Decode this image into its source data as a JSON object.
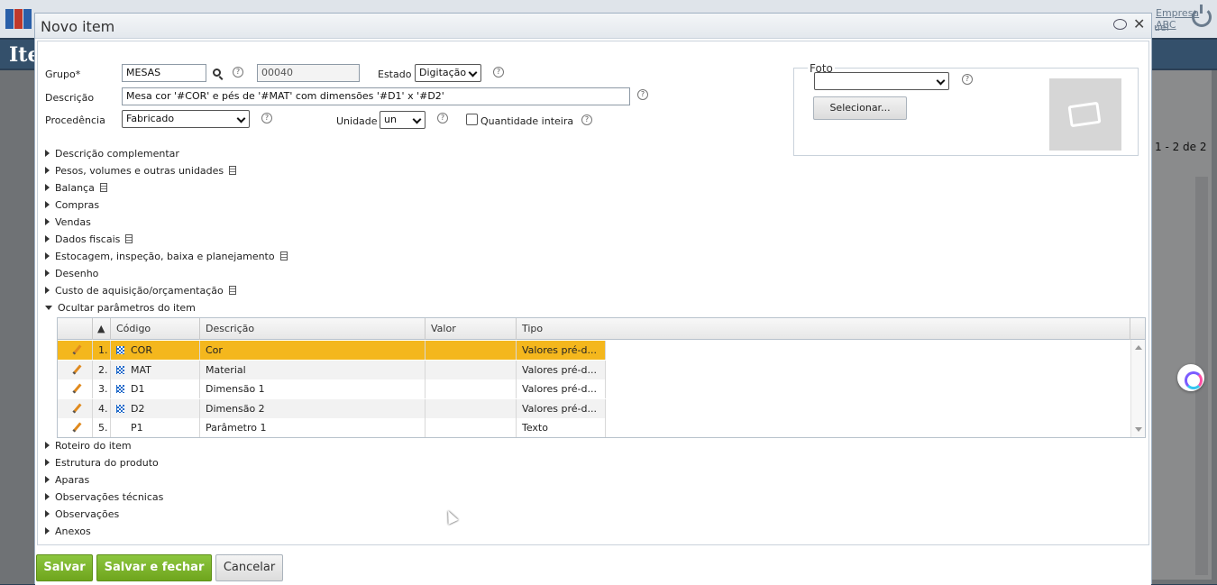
{
  "background": {
    "company": "Empresa ABC",
    "user": "uel",
    "page_title": "Ite",
    "pager": "1 - 2 de 2"
  },
  "modal": {
    "title": "Novo item",
    "form": {
      "grupo_label": "Grupo*",
      "grupo_value": "MESAS",
      "code_value": "00040",
      "estado_label": "Estado",
      "estado_value": "Digitação",
      "descricao_label": "Descrição",
      "descricao_value": "Mesa cor '#COR' e pés de '#MAT' com dimensões '#D1' x '#D2'",
      "procedencia_label": "Procedência",
      "procedencia_value": "Fabricado",
      "unidade_label": "Unidade",
      "unidade_value": "un",
      "qtd_inteira_label": "Quantidade inteira",
      "help_glyph": "?"
    },
    "foto": {
      "legend": "Foto",
      "select_value": "",
      "select_button": "Selecionar..."
    },
    "sections_top": [
      {
        "label": "Descrição complementar",
        "doc": false
      },
      {
        "label": "Pesos, volumes e outras unidades",
        "doc": true
      },
      {
        "label": "Balança",
        "doc": true
      },
      {
        "label": "Compras",
        "doc": false
      },
      {
        "label": "Vendas",
        "doc": false
      },
      {
        "label": "Dados fiscais",
        "doc": true
      },
      {
        "label": "Estocagem, inspeção, baixa e planejamento",
        "doc": true
      },
      {
        "label": "Desenho",
        "doc": false
      },
      {
        "label": "Custo de aquisição/orçamentação",
        "doc": true
      }
    ],
    "params_section": "Ocultar parâmetros do item",
    "grid": {
      "columns": [
        "Código",
        "Descrição",
        "Valor",
        "Tipo"
      ],
      "rows": [
        {
          "n": "1.",
          "code": "COR",
          "desc": "Cor",
          "valor": "",
          "tipo": "Valores pré-d...",
          "flag": true,
          "selected": true
        },
        {
          "n": "2.",
          "code": "MAT",
          "desc": "Material",
          "valor": "",
          "tipo": "Valores pré-d...",
          "flag": true,
          "selected": false
        },
        {
          "n": "3.",
          "code": "D1",
          "desc": "Dimensão 1",
          "valor": "",
          "tipo": "Valores pré-d...",
          "flag": true,
          "selected": false
        },
        {
          "n": "4.",
          "code": "D2",
          "desc": "Dimensão 2",
          "valor": "",
          "tipo": "Valores pré-d...",
          "flag": true,
          "selected": false
        },
        {
          "n": "5.",
          "code": "P1",
          "desc": "Parâmetro 1",
          "valor": "",
          "tipo": "Texto",
          "flag": false,
          "selected": false
        }
      ]
    },
    "sections_bottom": [
      "Roteiro do item",
      "Estrutura do produto",
      "Aparas",
      "Observações técnicas",
      "Observações",
      "Anexos"
    ],
    "buttons": {
      "salvar": "Salvar",
      "salvar_fechar": "Salvar e fechar",
      "cancelar": "Cancelar"
    },
    "colors": {
      "selected_row": "#f4b71d",
      "accent_green": "#7ab22a"
    }
  }
}
